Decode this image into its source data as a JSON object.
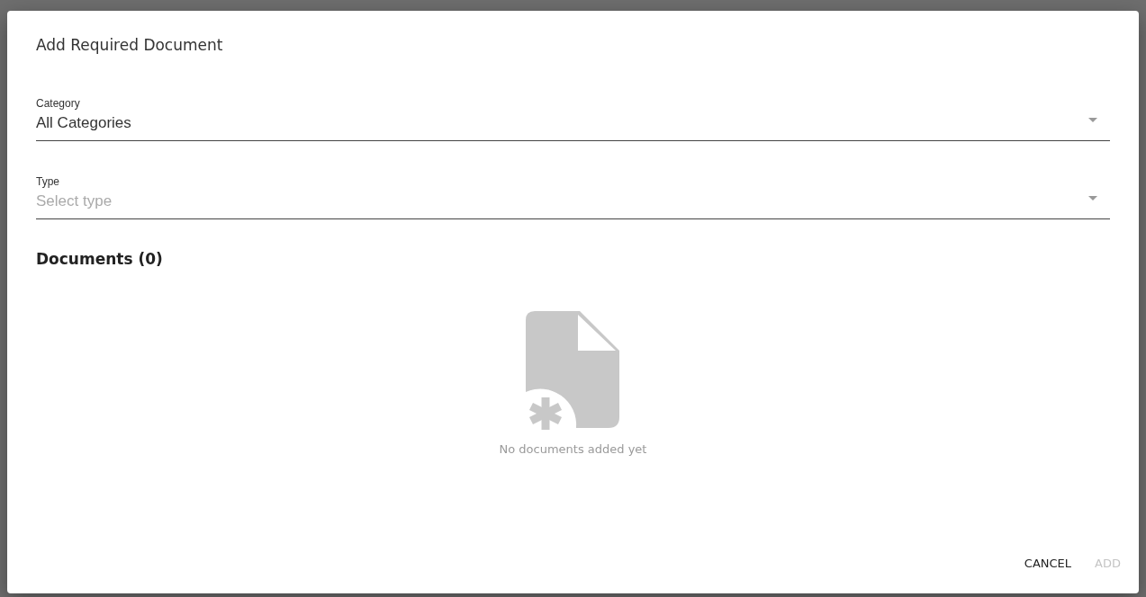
{
  "dialog": {
    "title": "Add Required Document"
  },
  "fields": [
    {
      "label": "Category",
      "value": "All Categories"
    },
    {
      "label": "Type",
      "placeholder": "Select type"
    }
  ],
  "documents": {
    "heading": "Documents (0)",
    "empty_text": "No documents added yet"
  },
  "buttons": [
    {
      "label": "CANCEL",
      "disabled": false
    },
    {
      "label": "ADD",
      "disabled": true
    }
  ]
}
